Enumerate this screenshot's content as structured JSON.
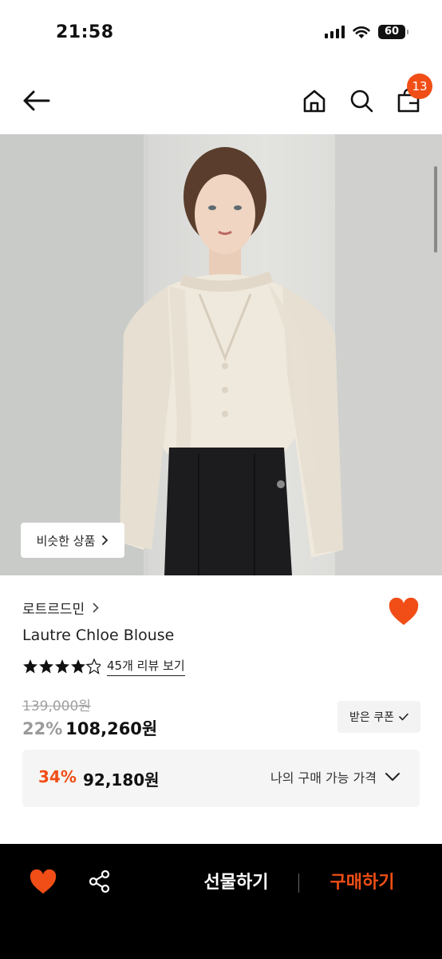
{
  "status_bar": {
    "time": "21:58",
    "battery": "60"
  },
  "header": {
    "cart_count": "13"
  },
  "hero": {
    "similar_label": "비슷한 상품"
  },
  "product": {
    "brand": "로트르드민",
    "name": "Lautre Chloe Blouse",
    "rating": 4.5,
    "review_link": "45개 리뷰 보기",
    "original_price": "139,000원",
    "discount_rate": "22%",
    "sale_price": "108,260원",
    "coupon_label": "받은 쿠폰"
  },
  "my_price": {
    "rate": "34%",
    "price": "92,180원",
    "label": "나의 구매 가능 가격"
  },
  "bottom_bar": {
    "gift_label": "선물하기",
    "buy_label": "구매하기"
  },
  "colors": {
    "accent": "#f04e16",
    "bottom_bar": "#000000"
  }
}
